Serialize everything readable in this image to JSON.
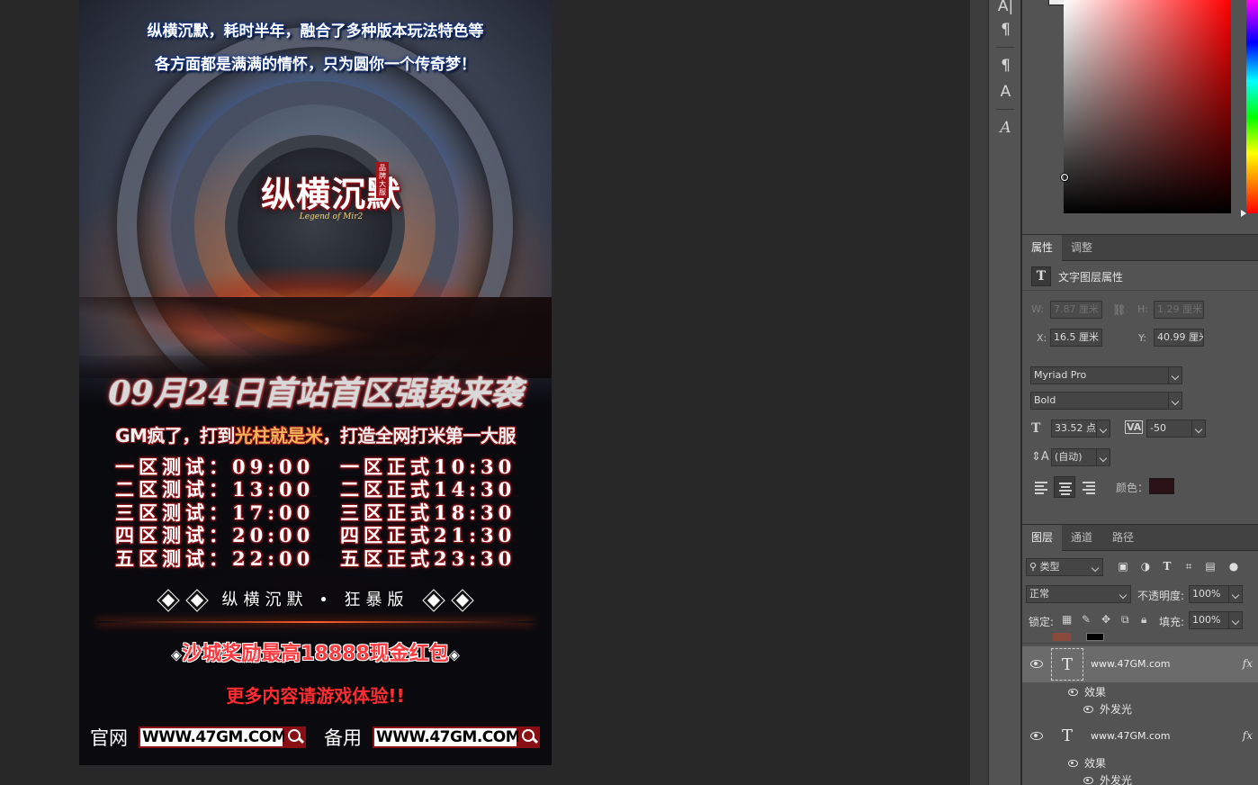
{
  "artwork": {
    "top_line_1": "纵横沉默，耗时半年，融合了多种版本玩法特色等",
    "top_line_2": "各方面都是满满的情怀，只为圆你一个传奇梦！",
    "logo_text": "纵横沉默",
    "logo_sub": "Legend of Mir2",
    "logo_seal": "品牌大服",
    "headline": "09月24日首站首区强势来袭",
    "gm_line_a": "GM疯了，打到",
    "gm_line_b": "光柱就是米",
    "gm_line_c": "，打造全网打米第一大服",
    "schedule": [
      {
        "test": "一区测试：09:00",
        "official": "一区正式10:30"
      },
      {
        "test": "二区测试：13:00",
        "official": "二区正式14:30"
      },
      {
        "test": "三区测试：17:00",
        "official": "三区正式18:30"
      },
      {
        "test": "四区测试：20:00",
        "official": "四区正式21:30"
      },
      {
        "test": "五区测试：22:00",
        "official": "五区正式23:30"
      }
    ],
    "banner": "纵横沉默 • 狂暴版",
    "reward_mark": "◈",
    "reward": "沙城奖励最高18888现金红包",
    "more": "更多内容请游戏体验!!",
    "official_label": "官网",
    "backup_label": "备用",
    "site_url": "WWW.47GM.COM",
    "accent_red": "#8a0f14"
  },
  "toolbar": {
    "icons": [
      "character-panel-icon",
      "paragraph-icon",
      "paragraph-styles-icon",
      "character-styles-icon",
      "glyphs-icon"
    ],
    "glyphs": [
      "A|",
      "¶",
      "¶",
      "A",
      "A"
    ]
  },
  "properties": {
    "tabs": [
      "属性",
      "调整"
    ],
    "title": "文字图层属性",
    "w_label": "W:",
    "w_value": "7.87 厘米",
    "h_label": "H:",
    "h_value": "1.29 厘米",
    "x_label": "X:",
    "x_value": "16.5 厘米",
    "y_label": "Y:",
    "y_value": "40.99 厘米",
    "font_family": "Myriad Pro",
    "font_style": "Bold",
    "font_size": "33.52 点",
    "tracking": "-50",
    "leading": "(自动)",
    "color_label": "颜色："
  },
  "layers": {
    "tabs": [
      "图层",
      "通道",
      "路径"
    ],
    "filter_kind": "类型",
    "blend_mode": "正常",
    "opacity_label": "不透明度:",
    "opacity_value": "100%",
    "lock_label": "锁定:",
    "fill_label": "填充:",
    "fill_value": "100%",
    "items": [
      {
        "name": "www.47GM.com",
        "effects_label": "效果",
        "effect": "外发光"
      },
      {
        "name": "www.47GM.com",
        "effects_label": "效果",
        "effect": "外发光"
      }
    ],
    "fx": "fx",
    "layer_glyph": "T"
  }
}
